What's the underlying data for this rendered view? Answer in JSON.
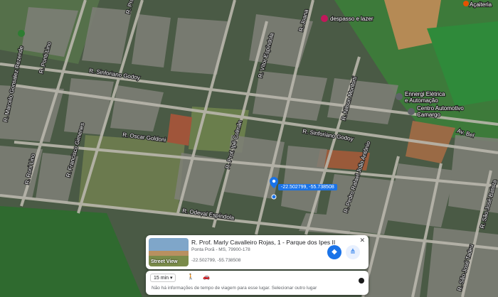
{
  "map": {
    "streets": [
      "R. Prof. Carlos",
      "R. Sinforiano Godoy",
      "R. Sinforiano Godoy",
      "R. Ponti Lino",
      "R. Marcelo Gonsalez Rezende",
      "R. Oscar Goldoni",
      "R. Francisco Gimenes",
      "R. Prof. Ipê Colmán",
      "R. Odeval Espíndola",
      "R. Sinforiano Godoy",
      "R. Nilson Monforti",
      "R. Vítor Espíndola",
      "Av. Bel",
      "R. Roni Lino",
      "R. Pedro Rafael João Antônio",
      "R. São José Batista",
      "R. São José Tadeu",
      "R. Joana"
    ],
    "pois": [
      "despasso e lazer",
      "Ennergi Elétrica e Automação",
      "Centro Automotivo Camargo",
      "Açaiteria"
    ],
    "pin_coordinates": "-22.502799, -55.738508"
  },
  "card": {
    "street_view_label": "Street View",
    "title": "R. Prof. Marly Cavalleiro Rojas, 1 - Parque dos Ipes II",
    "subtitle": "Ponta Porã - MS, 79900-178",
    "coordinates": "-22.502799, -55.738508",
    "close": "✕"
  },
  "travel": {
    "time_mode": "15 min",
    "message": "Não há informações de tempo de viagem para esse lugar. Selecionar outro lugar"
  },
  "colors": {
    "accent": "#1a73e8"
  }
}
